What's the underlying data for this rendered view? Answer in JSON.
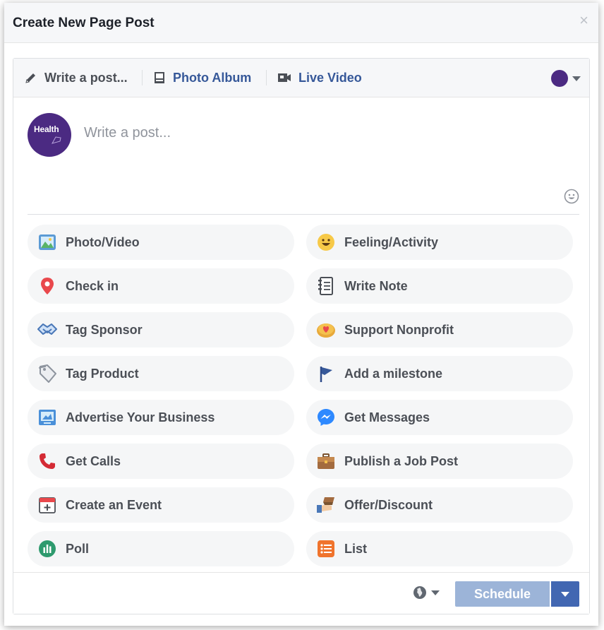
{
  "dialog": {
    "title": "Create New Page Post",
    "close_label": "×"
  },
  "tabs": [
    {
      "label": "Write a post...",
      "icon": "pencil-icon",
      "color": "#4b4f56"
    },
    {
      "label": "Photo Album",
      "icon": "photo-album-icon",
      "color": "#365899"
    },
    {
      "label": "Live Video",
      "icon": "video-camera-icon",
      "color": "#365899"
    }
  ],
  "composer": {
    "avatar_text": "Health",
    "placeholder": "Write a post..."
  },
  "options": [
    {
      "label": "Photo/Video",
      "icon": "photo-video-icon"
    },
    {
      "label": "Feeling/Activity",
      "icon": "smiley-face-icon"
    },
    {
      "label": "Check in",
      "icon": "location-pin-icon"
    },
    {
      "label": "Write Note",
      "icon": "notebook-icon"
    },
    {
      "label": "Tag Sponsor",
      "icon": "handshake-icon"
    },
    {
      "label": "Support Nonprofit",
      "icon": "heart-coin-icon"
    },
    {
      "label": "Tag Product",
      "icon": "tag-icon"
    },
    {
      "label": "Add a milestone",
      "icon": "flag-icon"
    },
    {
      "label": "Advertise Your Business",
      "icon": "advertise-icon"
    },
    {
      "label": "Get Messages",
      "icon": "messenger-icon"
    },
    {
      "label": "Get Calls",
      "icon": "phone-icon"
    },
    {
      "label": "Publish a Job Post",
      "icon": "briefcase-icon"
    },
    {
      "label": "Create an Event",
      "icon": "calendar-icon"
    },
    {
      "label": "Offer/Discount",
      "icon": "offer-tag-icon"
    },
    {
      "label": "Poll",
      "icon": "poll-icon"
    },
    {
      "label": "List",
      "icon": "list-icon"
    }
  ],
  "footer": {
    "schedule_label": "Schedule"
  },
  "colors": {
    "accent": "#4267b2",
    "link": "#365899",
    "schedule_disabled": "#9cb4d8",
    "page_avatar": "#4b2a82"
  }
}
